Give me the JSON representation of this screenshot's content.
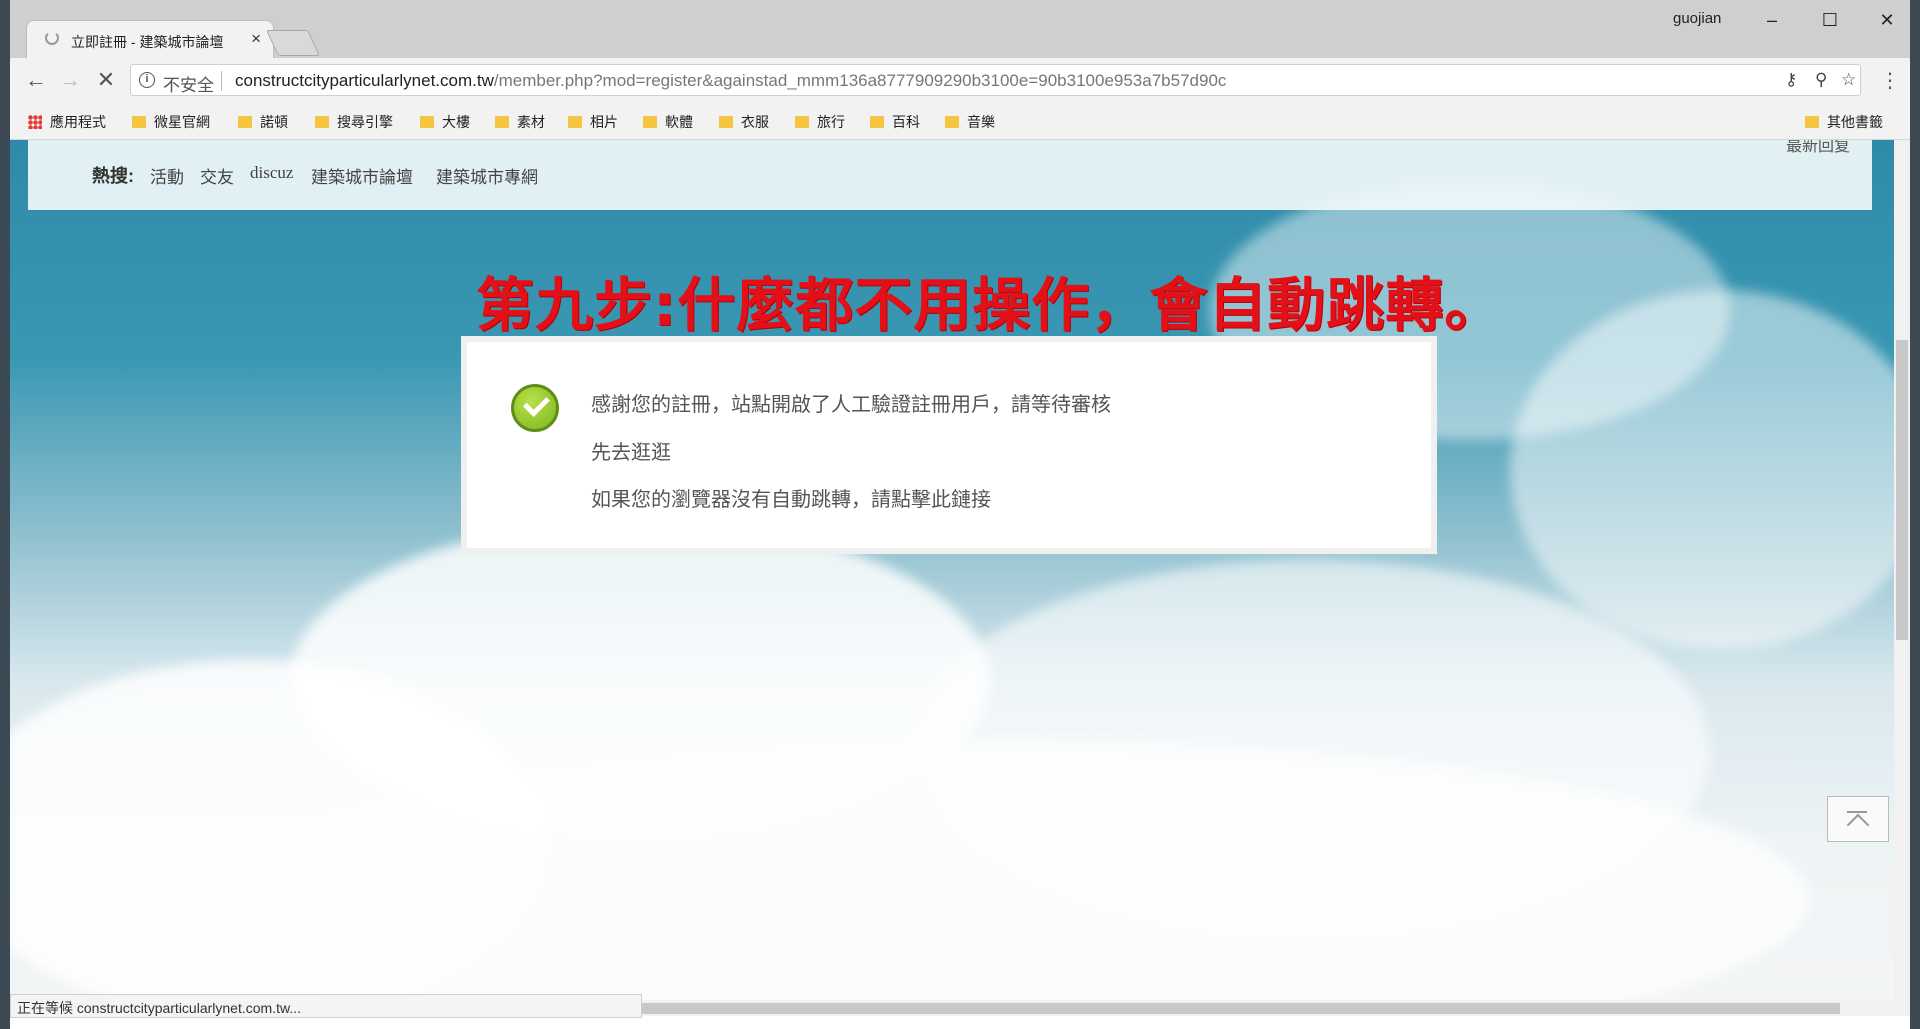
{
  "browser": {
    "tab_title": "立即註冊 - 建築城市論壇",
    "tab_close": "×",
    "user": "guojian",
    "security_label": "不安全",
    "url_host": "constructcityparticularlynet.com.tw",
    "url_path": "/member.php?mod=register&againstad_mmm136a8777909290b3100e=90b3100e953a7b57d90c",
    "status_text": "正在等候 constructcityparticularlynet.com.tw..."
  },
  "bookmarks": [
    "應用程式",
    "微星官網",
    "諾頓",
    "搜尋引擎",
    "大樓",
    "素材",
    "相片",
    "軟體",
    "衣服",
    "旅行",
    "百科",
    "音樂"
  ],
  "other_bookmarks": "其他書籤",
  "page": {
    "hot_label": "熱搜:",
    "hot_links": [
      "活動",
      "交友",
      "discuz",
      "建築城市論壇",
      "建築城市專網"
    ],
    "corner_text": "最新回复",
    "step_annotation": "第九步:什麼都不用操作，會自動跳轉。",
    "messages": [
      "感謝您的註冊，站點開啟了人工驗證註冊用戶，請等待審核",
      "先去逛逛",
      "如果您的瀏覽器沒有自動跳轉，請點擊此鏈接"
    ]
  },
  "colors": {
    "annotation_red": "#e31017",
    "check_green": "#7db522"
  },
  "icons": [
    "spinner-icon",
    "close-icon",
    "back-icon",
    "forward-icon",
    "stop-icon",
    "info-icon",
    "key-icon",
    "zoom-icon",
    "star-icon",
    "menu-icon",
    "folder-icon",
    "apps-icon",
    "check-icon",
    "back-to-top-icon"
  ]
}
